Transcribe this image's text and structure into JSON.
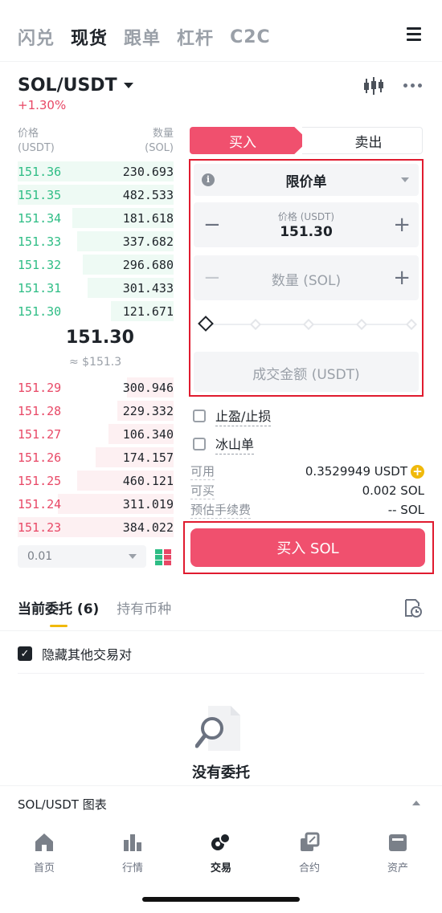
{
  "top_tabs": [
    "闪兑",
    "现货",
    "跟单",
    "杠杆",
    "C2C"
  ],
  "active_top_tab": "现货",
  "pair": {
    "name": "SOL/USDT",
    "change": "+1.30%"
  },
  "orderbook": {
    "price_header": "价格",
    "price_unit": "(USDT)",
    "qty_header": "数量",
    "qty_unit": "(SOL)",
    "bids": [
      {
        "price": "151.36",
        "qty": "230.693"
      },
      {
        "price": "151.35",
        "qty": "482.533"
      },
      {
        "price": "151.34",
        "qty": "181.618"
      },
      {
        "price": "151.33",
        "qty": "337.682"
      },
      {
        "price": "151.32",
        "qty": "296.680"
      },
      {
        "price": "151.31",
        "qty": "301.433"
      },
      {
        "price": "151.30",
        "qty": "121.671"
      }
    ],
    "mid_price": "151.30",
    "mid_usd": "≈ $151.3",
    "asks": [
      {
        "price": "151.29",
        "qty": "300.946"
      },
      {
        "price": "151.28",
        "qty": "229.332"
      },
      {
        "price": "151.27",
        "qty": "106.340"
      },
      {
        "price": "151.26",
        "qty": "174.157"
      },
      {
        "price": "151.25",
        "qty": "460.121"
      },
      {
        "price": "151.24",
        "qty": "311.019"
      },
      {
        "price": "151.23",
        "qty": "384.022"
      }
    ],
    "depth": "0.01"
  },
  "trade": {
    "buy_tab": "买入",
    "sell_tab": "卖出",
    "order_type": "限价单",
    "price_label": "价格 (USDT)",
    "price_value": "151.30",
    "qty_placeholder": "数量 (SOL)",
    "total_placeholder": "成交金额 (USDT)",
    "tp_sl_label": "止盈/止损",
    "iceberg_label": "冰山单",
    "available_label": "可用",
    "available_value": "0.3529949 USDT",
    "can_buy_label": "可买",
    "can_buy_value": "0.002 SOL",
    "fee_label": "预估手续费",
    "fee_value": "-- SOL",
    "buy_button": "买入 SOL"
  },
  "orders": {
    "tab_open": "当前委托 (6)",
    "tab_holdings": "持有币种",
    "hide_other_pairs": "隐藏其他交易对",
    "empty_text": "没有委托"
  },
  "chart_bar_label": "SOL/USDT 图表",
  "bottom_nav": [
    "首页",
    "行情",
    "交易",
    "合约",
    "资产"
  ],
  "active_nav": "交易",
  "colors": {
    "buy": "#f0506e",
    "bid": "#2ebd85",
    "ask": "#e84866",
    "accent": "#f0b90b",
    "highlight_border": "#e01b2f"
  }
}
